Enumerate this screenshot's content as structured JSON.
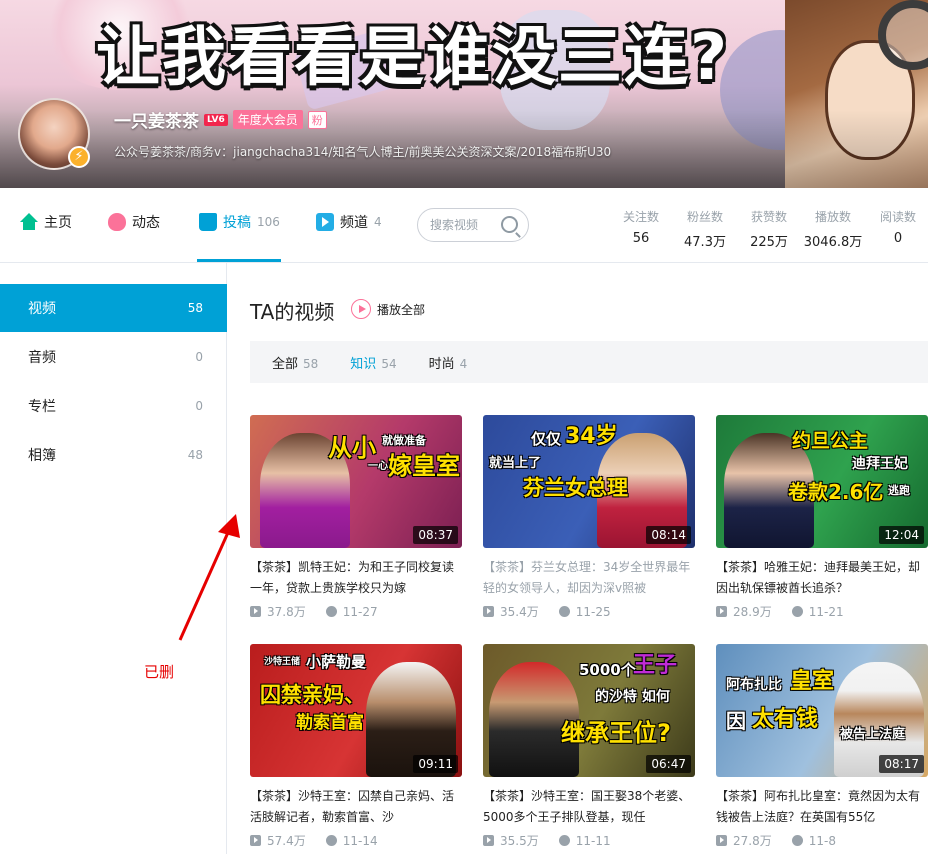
{
  "banner": {
    "title": "让我看看是谁没三连?",
    "user_name": "一只姜茶茶",
    "level": "LV6",
    "vip": "年度大会员",
    "fan_badge": "粉",
    "description": "公众号姜茶茶/商务v：jiangchacha314/知名气人博主/前奥美公关资深文案/2018福布斯U30"
  },
  "nav": {
    "items": [
      {
        "label": "主页",
        "count": ""
      },
      {
        "label": "动态",
        "count": ""
      },
      {
        "label": "投稿",
        "count": "106"
      },
      {
        "label": "频道",
        "count": "4"
      }
    ],
    "search_placeholder": "搜索视频",
    "stats": [
      {
        "label": "关注数",
        "value": "56"
      },
      {
        "label": "粉丝数",
        "value": "47.3万"
      },
      {
        "label": "获赞数",
        "value": "225万"
      },
      {
        "label": "播放数",
        "value": "3046.8万"
      },
      {
        "label": "阅读数",
        "value": "0"
      }
    ]
  },
  "sidebar": {
    "items": [
      {
        "label": "视频",
        "count": "58"
      },
      {
        "label": "音频",
        "count": "0"
      },
      {
        "label": "专栏",
        "count": "0"
      },
      {
        "label": "相簿",
        "count": "48"
      }
    ]
  },
  "main": {
    "section_title": "TA的视频",
    "play_all": "播放全部",
    "filters": [
      {
        "label": "全部",
        "count": "58"
      },
      {
        "label": "知识",
        "count": "54"
      },
      {
        "label": "时尚",
        "count": "4"
      }
    ]
  },
  "videos": [
    {
      "caption_a": "从小",
      "caption_b": "就做准备",
      "caption_c": "一心只想",
      "caption_d": "嫁皇室",
      "duration": "08:37",
      "title": "【茶茶】凯特王妃：为和王子同校复读一年，贷款上贵族学校只为嫁",
      "views": "37.8万",
      "date": "11-27"
    },
    {
      "caption_a": "仅仅",
      "caption_b": "34岁",
      "caption_c": "就当上了",
      "caption_d": "芬兰女总理",
      "duration": "08:14",
      "title": "【茶茶】芬兰女总理：34岁全世界最年轻的女领导人，却因为深v照被",
      "views": "35.4万",
      "date": "11-25"
    },
    {
      "caption_a": "约旦公主",
      "caption_b": "迪拜王妃",
      "caption_c": "卷款2.6亿",
      "caption_d": "逃跑",
      "duration": "12:04",
      "title": "【茶茶】哈雅王妃：迪拜最美王妃，却因出轨保镖被酋长追杀？",
      "views": "28.9万",
      "date": "11-21"
    },
    {
      "caption_a": "沙特王储",
      "caption_b": "小萨勒曼",
      "caption_c": "囚禁亲妈、",
      "caption_d": "勒索首富",
      "duration": "09:11",
      "title": "【茶茶】沙特王室：囚禁自己亲妈、活活肢解记者，勒索首富、沙",
      "views": "57.4万",
      "date": "11-14"
    },
    {
      "caption_a": "5000个",
      "caption_b": "王子",
      "caption_c": "的沙特 如何",
      "caption_d": "继承王位?",
      "duration": "06:47",
      "title": "【茶茶】沙特王室：国王娶38个老婆、5000多个王子排队登基，现任",
      "views": "35.5万",
      "date": "11-11"
    },
    {
      "caption_a": "阿布扎比",
      "caption_b": "皇室",
      "caption_c": "因",
      "caption_d": "太有钱",
      "caption_e": "被告上法庭",
      "duration": "08:17",
      "title": "【茶茶】阿布扎比皇室：竟然因为太有钱被告上法庭？在英国有55亿",
      "views": "27.8万",
      "date": "11-8"
    }
  ],
  "annotation": {
    "deleted_note": "已删"
  },
  "colors": {
    "accent": "#00a1d6",
    "pink": "#fb7299",
    "annotation_red": "#e60000"
  }
}
